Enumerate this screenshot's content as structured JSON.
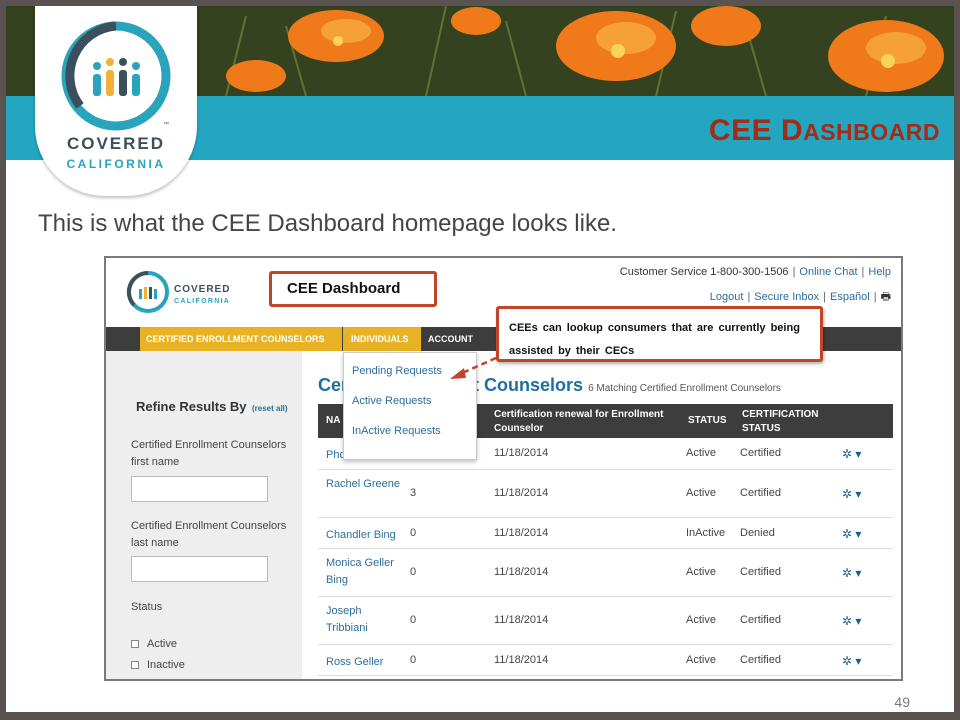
{
  "slide": {
    "title_main": "CEE D",
    "title_rest": "ASHBOARD",
    "subtitle": "This is what the CEE Dashboard homepage looks like.",
    "page_number": "49",
    "logo": {
      "line1": "COVERED",
      "line2": "CALIFORNIA",
      "tm": "™"
    }
  },
  "screenshot": {
    "logo": {
      "line1": "COVERED",
      "line2": "CALIFORNIA"
    },
    "dashboard_label": "CEE Dashboard",
    "header_links": {
      "customer_service": "Customer Service 1-800-300-1506",
      "online_chat": "Online Chat",
      "help": "Help",
      "logout": "Logout",
      "secure_inbox": "Secure Inbox",
      "espanol": "Español",
      "print_icon": "printer-icon"
    },
    "nav": {
      "tab_counselors": "CERTIFIED ENROLLMENT COUNSELORS",
      "tab_individuals": "INDIVIDUALS",
      "tab_account": "ACCOUNT"
    },
    "dropdown": {
      "pending": "Pending Requests",
      "active": "Active Requests",
      "inactive": "InActive Requests"
    },
    "callout": "CEEs can lookup consumers that are currently being assisted by their CECs",
    "sidebar": {
      "title": "Refine Results By",
      "reset": "(reset all)",
      "first_name_label": "Certified Enrollment Counselors first name",
      "last_name_label": "Certified Enrollment Counselors last name",
      "status_label": "Status",
      "active_label": "Active",
      "inactive_label": "Inactive"
    },
    "main": {
      "heading_left": "Cer",
      "heading_right": "ent Counselors",
      "count_text": "6 Matching Certified Enrollment Counselors"
    },
    "table": {
      "headers": {
        "name": "NA",
        "renewal": "Certification renewal for Enrollment Counselor",
        "status": "STATUS",
        "cert_status": "CERTIFICATION STATUS"
      },
      "rows": [
        {
          "name": "Pho",
          "count": "",
          "date": "11/18/2014",
          "status": "Active",
          "cert": "Certified"
        },
        {
          "name": "Rachel Greene",
          "count": "3",
          "date": "11/18/2014",
          "status": "Active",
          "cert": "Certified"
        },
        {
          "name": "Chandler Bing",
          "count": "0",
          "date": "11/18/2014",
          "status": "InActive",
          "cert": "Denied"
        },
        {
          "name": "Monica Geller Bing",
          "count": "0",
          "date": "11/18/2014",
          "status": "Active",
          "cert": "Certified"
        },
        {
          "name": "Joseph Tribbiani",
          "count": "0",
          "date": "11/18/2014",
          "status": "Active",
          "cert": "Certified"
        },
        {
          "name": "Ross Geller",
          "count": "0",
          "date": "11/18/2014",
          "status": "Active",
          "cert": "Certified"
        }
      ],
      "gear_glyph": "✲ ▾"
    }
  }
}
